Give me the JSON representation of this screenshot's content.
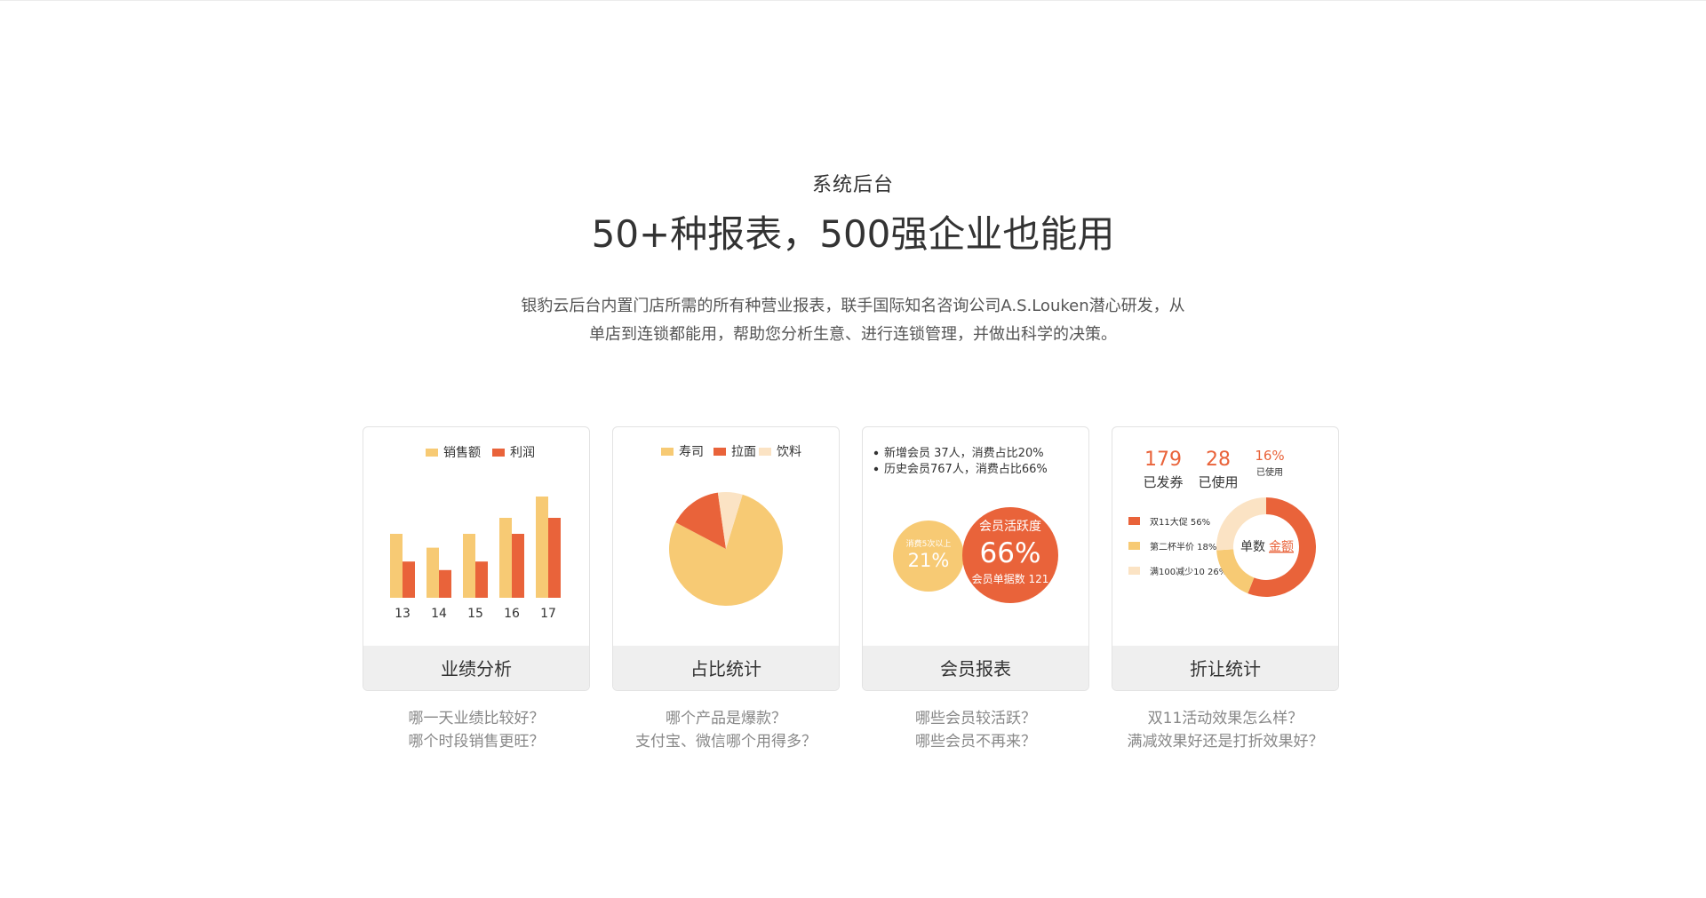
{
  "header": {
    "subtitle": "系统后台",
    "title": "50+种报表，500强企业也能用",
    "desc_line1": "银豹云后台内置门店所需的所有种营业报表，联手国际知名咨询公司A.S.Louken潜心研发，从",
    "desc_line2": "单店到连锁都能用，帮助您分析生意、进行连锁管理，并做出科学的决策。"
  },
  "colors": {
    "yellow": "#f7ca74",
    "orange": "#e9633a",
    "cream": "#fbe3c4",
    "gray_bar": "#efefef"
  },
  "cards": [
    {
      "label": "业绩分析",
      "q1": "哪一天业绩比较好？",
      "q2": "哪个时段销售更旺？"
    },
    {
      "label": "占比统计",
      "q1": "哪个产品是爆款？",
      "q2": "支付宝、微信哪个用得多？"
    },
    {
      "label": "会员报表",
      "q1": "哪些会员较活跃？",
      "q2": "哪些会员不再来？"
    },
    {
      "label": "折让统计",
      "q1": "双11活动效果怎么样？",
      "q2": "满减效果好还是打折效果好？"
    }
  ],
  "chart_data": [
    {
      "type": "bar",
      "categories": [
        "13",
        "14",
        "15",
        "16",
        "17"
      ],
      "series": [
        {
          "name": "销售额",
          "values": [
            6,
            4.7,
            6,
            7.5,
            9.5
          ]
        },
        {
          "name": "利润",
          "values": [
            3.4,
            2.6,
            3.4,
            6,
            7.5
          ]
        }
      ],
      "ylim": [
        0,
        10
      ],
      "legend": "top-center"
    },
    {
      "type": "pie",
      "categories": [
        "寿司",
        "拉面",
        "饮料"
      ],
      "values": [
        78,
        15,
        7
      ],
      "legend": "top-center"
    },
    {
      "type": "bubble",
      "items": [
        "新增会员 37人，消费占比20%",
        "历史会员767人，消费占比66%"
      ],
      "small_caption": "消费5次以上",
      "small_value": "21%",
      "big_caption": "会员活跃度",
      "big_value": "66%",
      "big_sub": "会员单据数 121"
    },
    {
      "type": "donut",
      "stats": [
        {
          "value": "179",
          "label": "已发券"
        },
        {
          "value": "28",
          "label": "已使用"
        },
        {
          "value": "16%",
          "label": "已使用"
        }
      ],
      "categories": [
        "双11大促 56%",
        "第二杯半价 18%",
        "满100减少10 26%"
      ],
      "values": [
        56,
        18,
        26
      ],
      "center_label": "单数",
      "center_link": "金额"
    }
  ]
}
